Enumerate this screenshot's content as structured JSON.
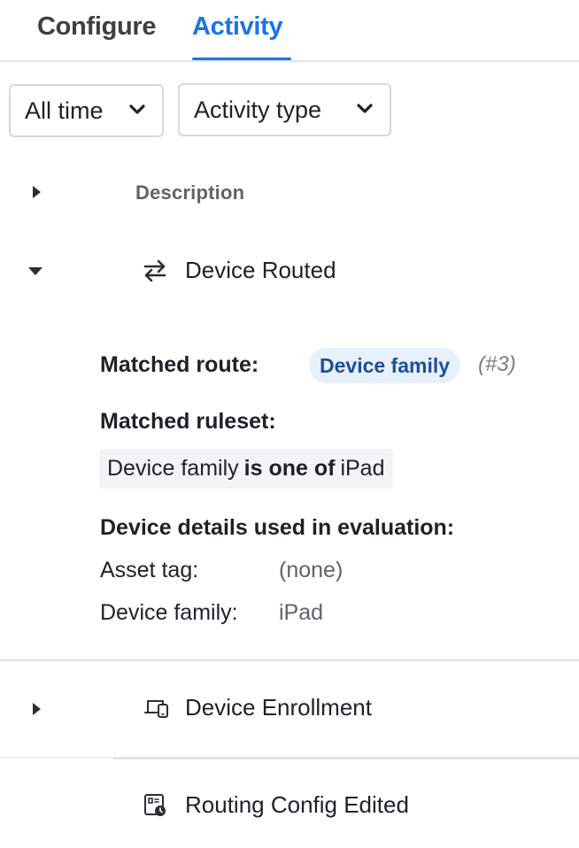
{
  "tabs": [
    {
      "label": "Configure",
      "active": false
    },
    {
      "label": "Activity",
      "active": true
    }
  ],
  "filters": {
    "time": {
      "label": "All time",
      "icon": "chevron-down-icon"
    },
    "activity_type": {
      "label": "Activity type",
      "icon": "chevron-down-icon"
    }
  },
  "table": {
    "column_description": "Description"
  },
  "rows": [
    {
      "title": "Device Routed",
      "icon": "swap-arrows-icon",
      "expanded": true,
      "details": {
        "matched_route_label": "Matched route:",
        "matched_route_badge": "Device family",
        "matched_route_index": "(#3)",
        "matched_ruleset_label": "Matched ruleset:",
        "rule": {
          "field": "Device family",
          "operator": "is one of",
          "value": "iPad"
        },
        "device_details_label": "Device details used in evaluation:",
        "device_details": [
          {
            "key": "Asset tag:",
            "value": "(none)"
          },
          {
            "key": "Device family:",
            "value": "iPad"
          }
        ]
      }
    },
    {
      "title": "Device Enrollment",
      "icon": "devices-icon",
      "expanded": false
    },
    {
      "title": "Routing Config Edited",
      "icon": "config-edit-icon",
      "expanded": false
    }
  ],
  "colors": {
    "accent": "#1a73e8",
    "badge_bg": "#e7f0fd",
    "badge_text": "#1f4e9a"
  }
}
